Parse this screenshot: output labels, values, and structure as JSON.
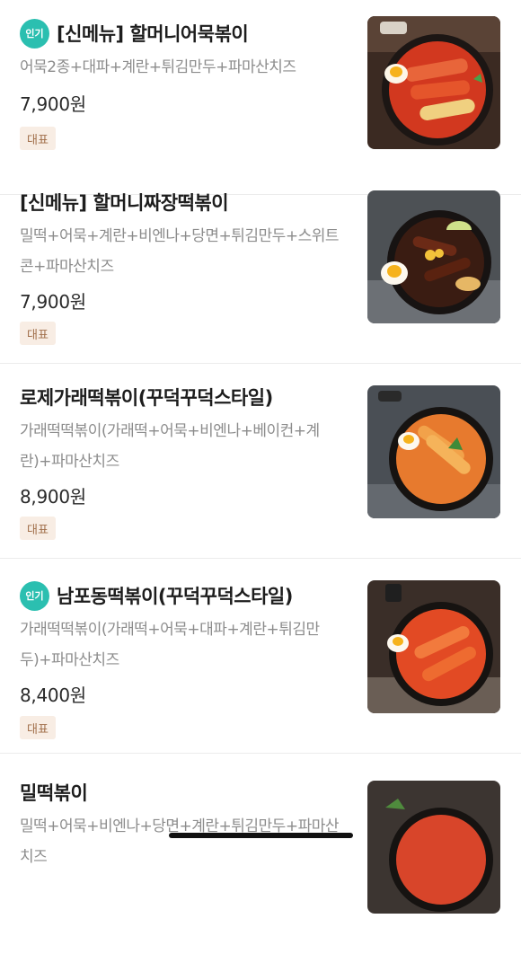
{
  "menu": {
    "items": [
      {
        "badge": "인기",
        "title": "[신메뉴] 할머니어묵볶이",
        "description": "어묵2종+대파+계란+튀김만두+파마산치즈",
        "price": "7,900원",
        "tag": "대표",
        "image": "fishcake-tteokbokki-photo"
      },
      {
        "badge": "",
        "title": "[신메뉴] 할머니짜장떡볶이",
        "description": "밀떡+어묵+계란+비엔나+당면+튀김만두+스위트콘+파마산치즈",
        "price": "7,900원",
        "tag": "대표",
        "image": "jjajang-tteokbokki-photo"
      },
      {
        "badge": "",
        "title": "로제가래떡볶이(꾸덕꾸덕스타일)",
        "description": "가래떡떡볶이(가래떡+어묵+비엔나+베이컨+계란)+파마산치즈",
        "price": "8,900원",
        "tag": "대표",
        "image": "rose-tteokbokki-photo"
      },
      {
        "badge": "인기",
        "title": "남포동떡볶이(꾸덕꾸덕스타일)",
        "description": "가래떡떡볶이(가래떡+어묵+대파+계란+튀김만두)+파마산치즈",
        "price": "8,400원",
        "tag": "대표",
        "image": "nampodong-tteokbokki-photo"
      },
      {
        "badge": "",
        "title": "밀떡볶이",
        "description": "밀떡+어묵+비엔나+당면+계란+튀김만두+파마산치즈",
        "price": "",
        "tag": "",
        "image": "wheat-tteokbokki-photo"
      }
    ]
  },
  "colors": {
    "popular_badge": "#2bbfb0",
    "tag_bg": "#f8ede4",
    "tag_text": "#a06e49",
    "description": "#8c8c8c"
  }
}
